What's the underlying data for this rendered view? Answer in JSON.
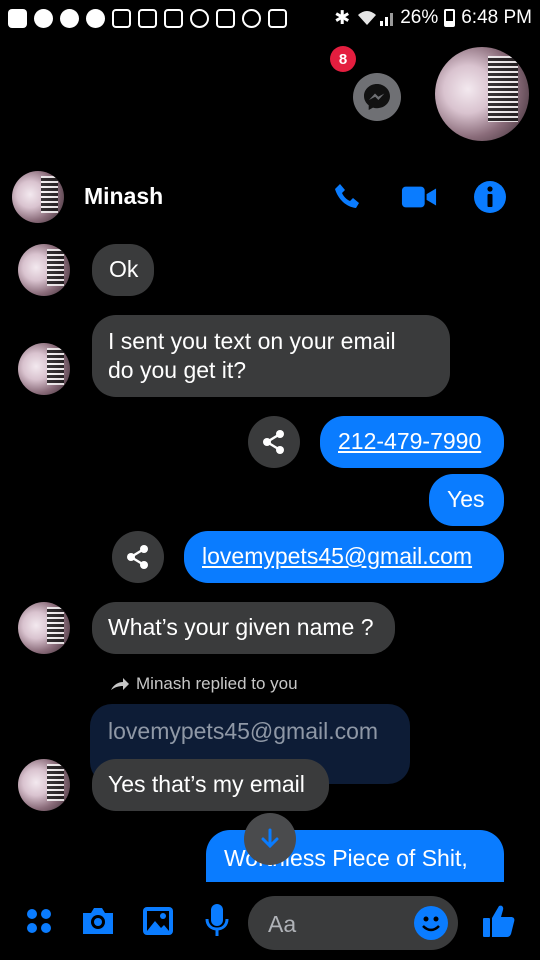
{
  "status_bar": {
    "battery": "26%",
    "time": "6:48 PM",
    "battery_level": 0.26
  },
  "chat_heads": {
    "badge_count": "8"
  },
  "header": {
    "name": "Minash"
  },
  "messages": {
    "m1": "Ok",
    "m2_line1": "I sent you text on your email",
    "m2_line2": "do you get it?",
    "m3": "212-479-7990",
    "m4": "Yes",
    "m5": "lovemypets45@gmail.com",
    "m6": "What’s your given name ?",
    "reply_label": "Minash replied to you",
    "quoted": "lovemypets45@gmail.com",
    "m7": "Yes that’s my email",
    "m8": "Worthless Piece of Shit,"
  },
  "composer": {
    "placeholder": "Aa"
  },
  "colors": {
    "accent": "#0a7cff",
    "incoming_bubble": "#3a3b3c",
    "badge": "#e41e3f"
  }
}
